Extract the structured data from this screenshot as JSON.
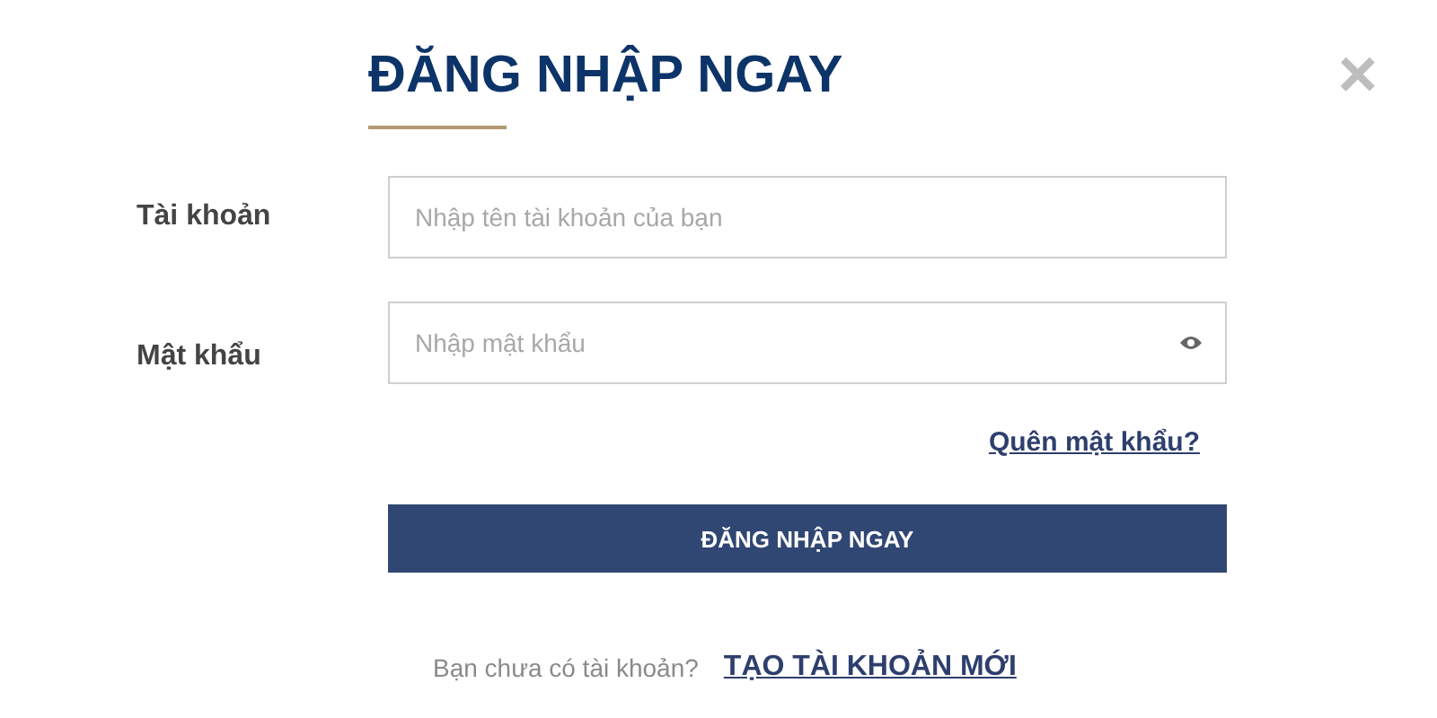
{
  "title": "ĐĂNG NHẬP NGAY",
  "close": "×",
  "fields": [
    {
      "label": "Tài khoản",
      "placeholder": "Nhập tên tài khoản của bạn",
      "kind": "text"
    },
    {
      "label": "Mật khẩu",
      "placeholder": "Nhập mật khẩu",
      "kind": "password"
    }
  ],
  "forgot_link": "Quên mật khẩu?",
  "submit": "ĐĂNG NHẬP NGAY",
  "signup_prompt": "Bạn chưa có tài khoản?",
  "signup_link": "TẠO TÀI KHOẢN MỚI"
}
